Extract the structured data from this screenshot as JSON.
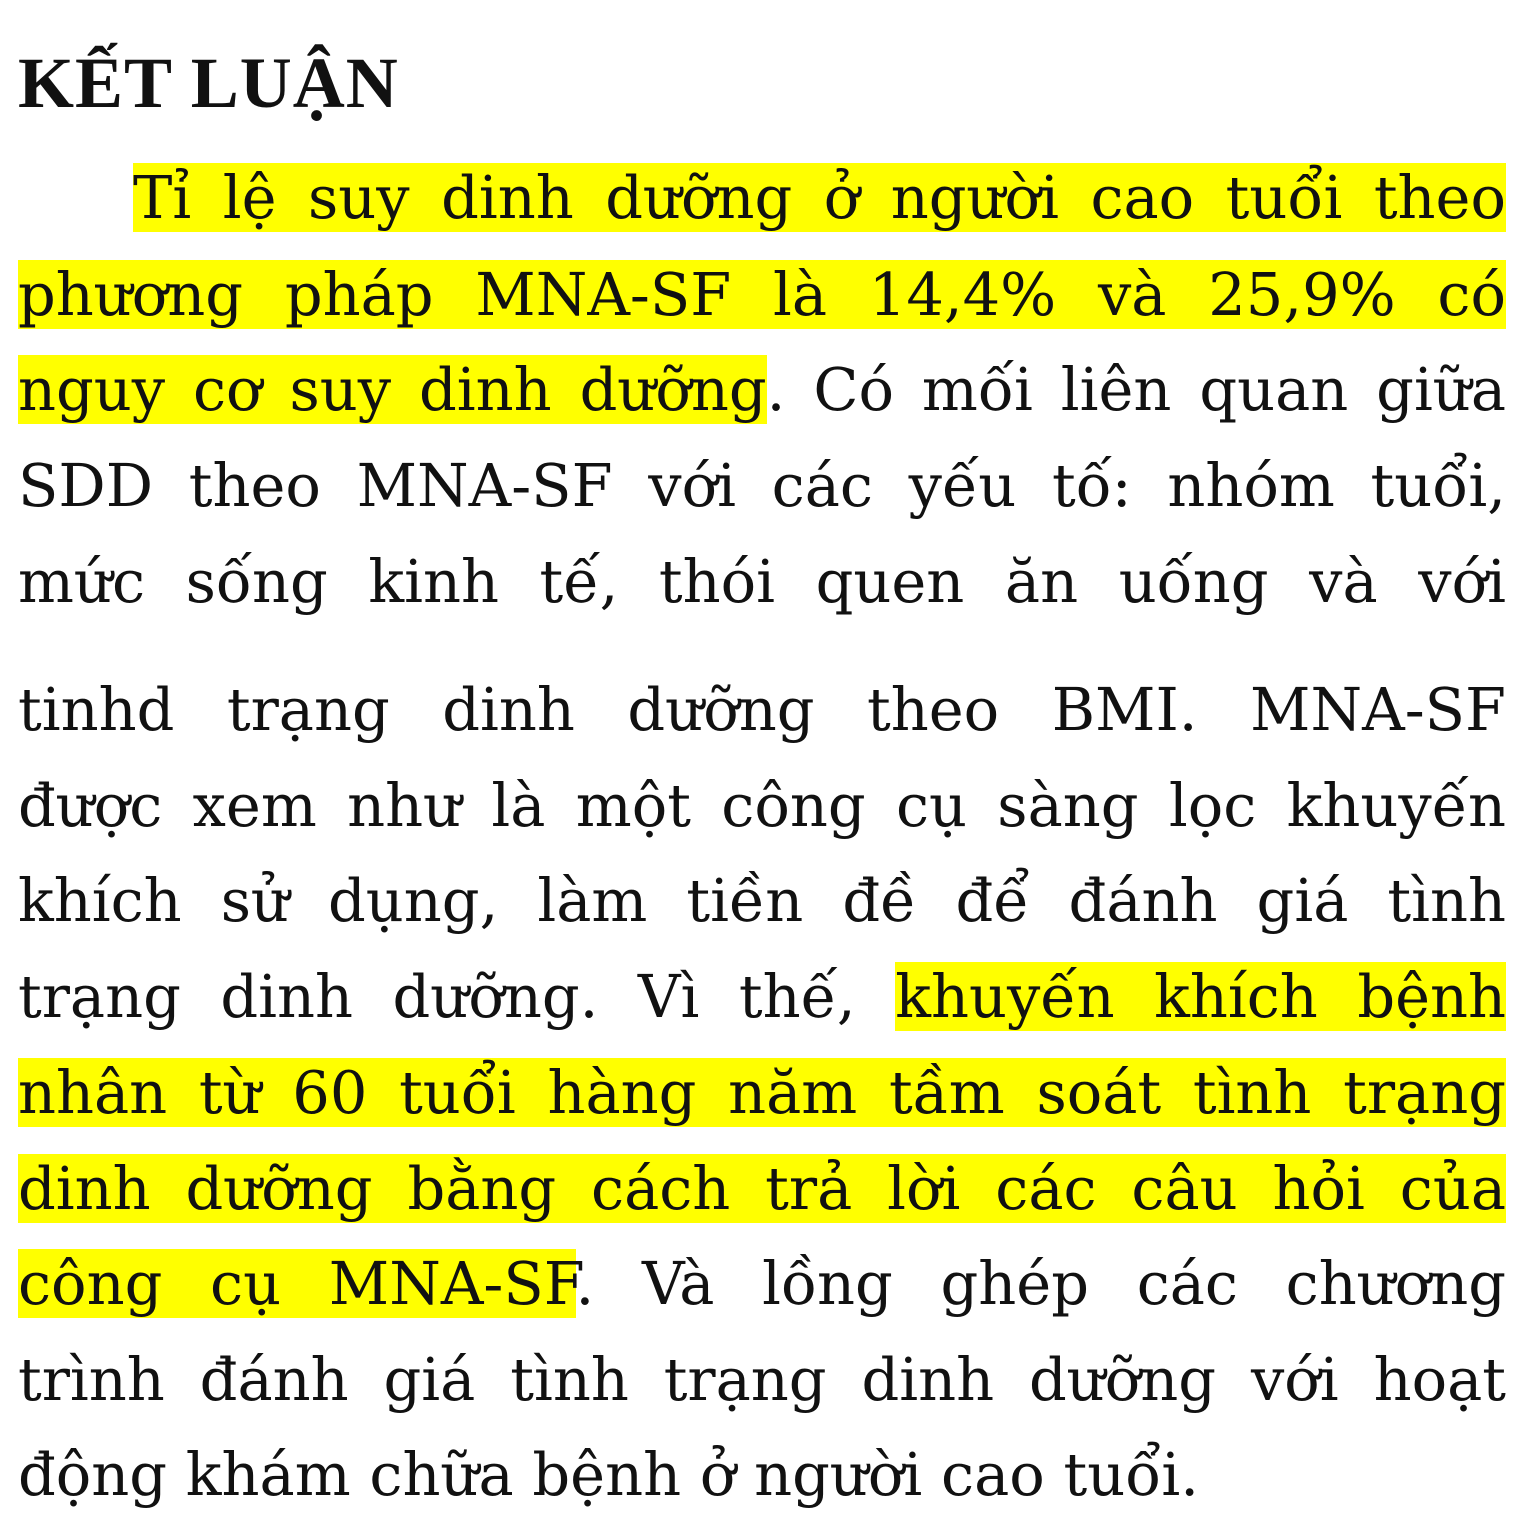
{
  "heading": "KẾT LUẬN",
  "highlight_color": "#ffff00",
  "lines": [
    [
      "",
      "Tỉ lệ suy dinh dưỡng ở người cao tuổi theo",
      ""
    ],
    [
      "",
      "phương pháp MNA-SF là 14,4% và 25,9% có",
      ""
    ],
    [
      "",
      "nguy cơ suy dinh dưỡng",
      ". Có mối liên quan giữa"
    ],
    [
      "SDD theo MNA-SF với các yếu tố: nhóm tuổi,",
      "",
      ""
    ],
    [
      "mức sống kinh tế, thói quen ăn uống và với",
      "",
      ""
    ],
    [
      "tinhd trạng dinh dưỡng theo BMI. MNA-SF",
      "",
      ""
    ],
    [
      "được xem như là một công cụ sàng lọc khuyến",
      "",
      ""
    ],
    [
      "khích sử dụng, làm tiền đề để đánh giá tình",
      "",
      ""
    ],
    [
      "trạng dinh dưỡng. Vì thế, ",
      "khuyến khích bệnh",
      ""
    ],
    [
      "",
      "nhân từ 60 tuổi hàng năm tầm soát tình trạng",
      ""
    ],
    [
      "",
      "dinh dưỡng bằng cách trả lời các câu hỏi của",
      ""
    ],
    [
      "",
      "công cụ MNA-SF",
      ". Và lồng ghép các chương"
    ],
    [
      "trình đánh giá tình trạng dinh dưỡng với hoạt",
      "",
      ""
    ],
    [
      "động khám chữa bệnh ở người cao tuổi.",
      "",
      ""
    ]
  ]
}
